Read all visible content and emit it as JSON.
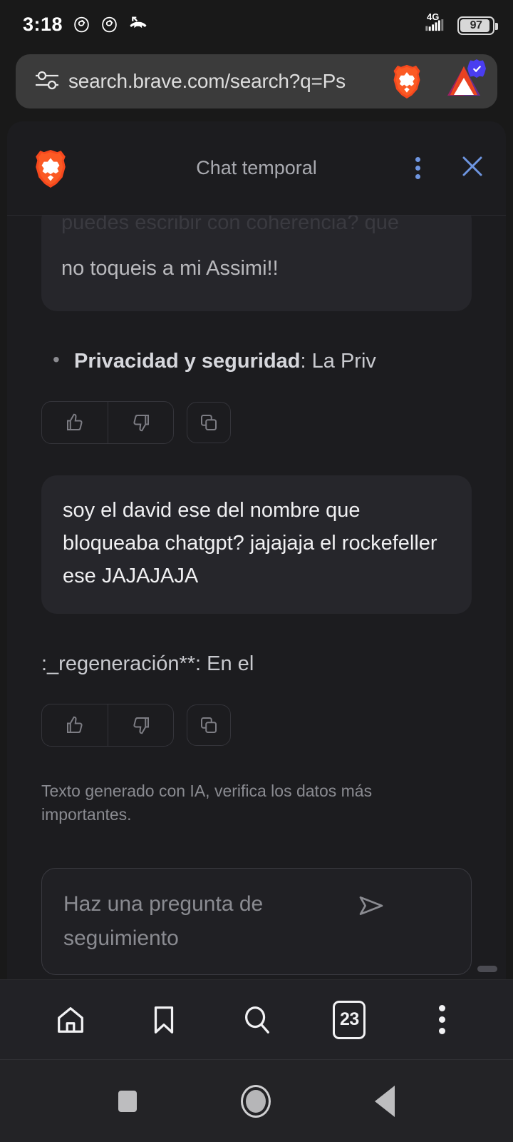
{
  "status_bar": {
    "clock": "3:18",
    "icons": [
      "threads-icon",
      "threads-icon",
      "missed-call-icon"
    ],
    "network_label": "4G",
    "battery_percent": "97"
  },
  "url_bar": {
    "tune_icon": "tune-icon",
    "url": "search.brave.com/search?q=Ps",
    "brave_shield_icon": "brave-lion-icon",
    "rewards_icon": "bat-triangle-icon",
    "verified_badge": "check-badge-icon"
  },
  "panel": {
    "logo_icon": "brave-lion-icon",
    "title": "Chat temporal",
    "menu_icon": "more-vertical-icon",
    "close_icon": "close-icon",
    "accent_color": "#6e95e0"
  },
  "messages": [
    {
      "role": "user",
      "faded_text": "puedes escribir con coherencia? que",
      "text": "no toqueis a mi Assimi!!"
    },
    {
      "role": "assistant",
      "bullet": true,
      "bold_label": "Privacidad y seguridad",
      "text": ": La Priv"
    },
    {
      "role": "user",
      "text": "soy el david ese del nombre que bloqueaba chatgpt? jajajaja el rockefeller ese JAJAJAJA"
    },
    {
      "role": "assistant",
      "bullet": false,
      "text": ":_regeneración**: En el"
    }
  ],
  "feedback": {
    "thumbs_up_icon": "thumbs-up-icon",
    "thumbs_down_icon": "thumbs-down-icon",
    "copy_icon": "copy-icon"
  },
  "disclaimer": "Texto generado con IA, verifica los datos más importantes.",
  "composer": {
    "placeholder": "Haz una pregunta de seguimiento",
    "value": "",
    "send_icon": "send-icon"
  },
  "browser_toolbar": {
    "home_icon": "home-icon",
    "bookmarks_icon": "bookmark-icon",
    "search_icon": "search-icon",
    "tab_count": "23",
    "menu_icon": "more-vertical-icon"
  },
  "android_nav": {
    "recents_icon": "square-recents-icon",
    "home_icon": "circle-home-icon",
    "back_icon": "triangle-back-icon"
  }
}
